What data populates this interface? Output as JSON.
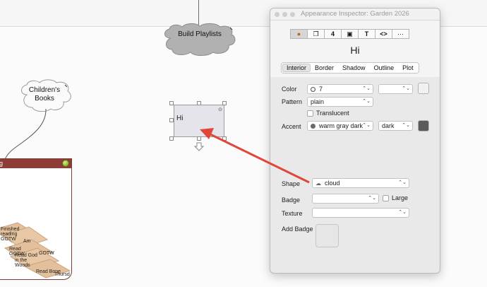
{
  "canvas": {
    "notes": [
      {
        "label": "Build Playlists"
      },
      {
        "label": "Children's Books"
      }
    ],
    "hi_note": {
      "text": "Hi"
    },
    "map_note": {
      "title": "g",
      "items": [
        "Finished reading GOTW",
        "Am",
        "Read GOTW",
        "GOTW",
        "Read God in the Woods",
        "Read Bone",
        "Thursd"
      ]
    }
  },
  "inspector": {
    "title": "Appearance Inspector: Garden 2026",
    "note_name": "Hi",
    "toolbar_icons": [
      "appearance-icon",
      "shadow-square-icon",
      "number-4-icon",
      "frame-icon",
      "text-T-icon",
      "code-brackets-icon",
      "more-ellipsis-icon"
    ],
    "toolbar_glyphs": [
      "●",
      "❐",
      "4",
      "▣",
      "T",
      "<>",
      "⋯"
    ],
    "tabs": [
      "Interior",
      "Border",
      "Shadow",
      "Outline",
      "Plot"
    ],
    "active_tab": "Interior",
    "color": {
      "label": "Color",
      "value": "7",
      "second_value": "",
      "swatch": "#f1f1f1"
    },
    "pattern": {
      "label": "Pattern",
      "value": "plain"
    },
    "translucent": {
      "label": "Translucent",
      "checked": false
    },
    "accent": {
      "label": "Accent",
      "value": "warm gray dark",
      "shade": "dark",
      "swatch": "#5a5a5a"
    },
    "shape": {
      "label": "Shape",
      "value": "cloud"
    },
    "badge": {
      "label": "Badge",
      "value": "",
      "large_label": "Large",
      "large_checked": false
    },
    "texture": {
      "label": "Texture",
      "value": ""
    },
    "add_badge": {
      "label": "Add Badge"
    }
  },
  "colors": {
    "arrow": "#e2463a",
    "map_note_title": "#8d3c36",
    "accent_dot": "#6a6a6a",
    "color_dot": "#f4f4f4"
  }
}
